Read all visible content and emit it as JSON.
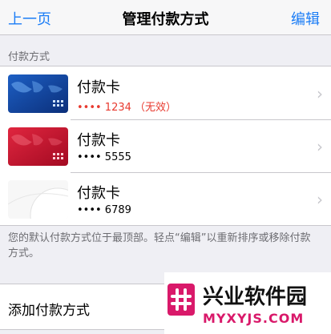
{
  "nav": {
    "back_label": "上一页",
    "title": "管理付款方式",
    "edit_label": "编辑"
  },
  "section": {
    "header": "付款方式"
  },
  "cards": [
    {
      "name": "付款卡",
      "number": "•••• 1234 （无效）",
      "status": "invalid",
      "style": "blue-map"
    },
    {
      "name": "付款卡",
      "number": "•••• 5555",
      "status": "valid",
      "style": "red-map"
    },
    {
      "name": "付款卡",
      "number": "•••• 6789",
      "status": "valid",
      "style": "white"
    }
  ],
  "footnote": "您的默认付款方式位于最顶部。轻点“编辑”以重新排序或移除付款方式。",
  "add_payment": {
    "label": "添加付款方式"
  },
  "watermark": {
    "title": "兴业软件园",
    "url": "MYXYJS.COM"
  },
  "colors": {
    "accent": "#1a7cf6",
    "invalid": "#e83a2f",
    "watermark": "#d9196a"
  }
}
